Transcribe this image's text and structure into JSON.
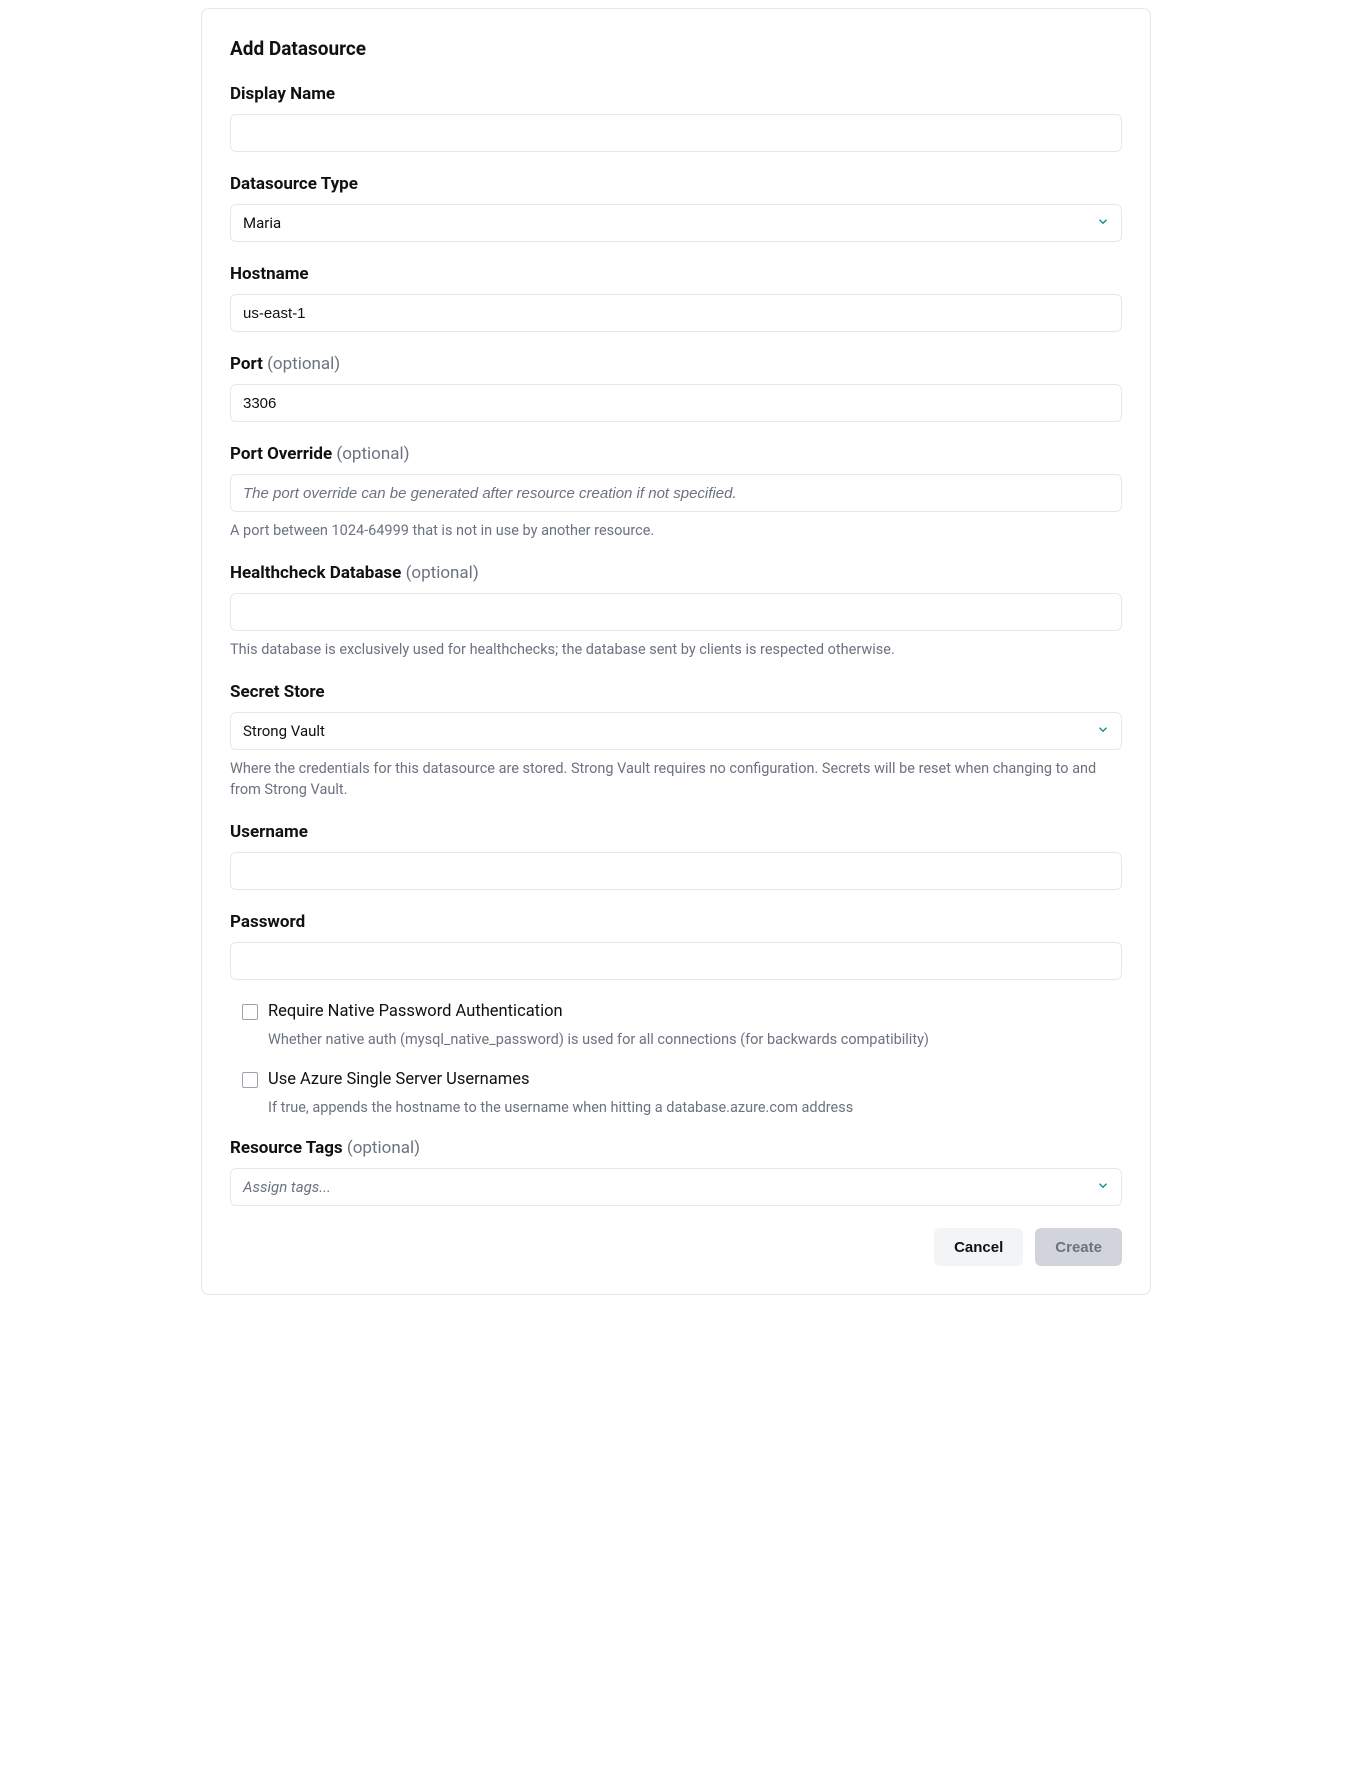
{
  "title": "Add Datasource",
  "fields": {
    "displayName": {
      "label": "Display Name",
      "value": ""
    },
    "datasourceType": {
      "label": "Datasource Type",
      "value": "Maria"
    },
    "hostname": {
      "label": "Hostname",
      "value": "us-east-1"
    },
    "port": {
      "label": "Port",
      "optional": "(optional)",
      "value": "3306"
    },
    "portOverride": {
      "label": "Port Override",
      "optional": "(optional)",
      "placeholder": "The port override can be generated after resource creation if not specified.",
      "help": "A port between 1024-64999 that is not in use by another resource."
    },
    "healthcheckDb": {
      "label": "Healthcheck Database",
      "optional": "(optional)",
      "value": "",
      "help": "This database is exclusively used for healthchecks; the database sent by clients is respected otherwise."
    },
    "secretStore": {
      "label": "Secret Store",
      "value": "Strong Vault",
      "help": "Where the credentials for this datasource are stored. Strong Vault requires no configuration. Secrets will be reset when changing to and from Strong Vault."
    },
    "username": {
      "label": "Username",
      "value": ""
    },
    "password": {
      "label": "Password",
      "value": ""
    },
    "requireNativePassword": {
      "label": "Require Native Password Authentication",
      "help": "Whether native auth (mysql_native_password) is used for all connections (for backwards compatibility)"
    },
    "azureUsernames": {
      "label": "Use Azure Single Server Usernames",
      "help": "If true, appends the hostname to the username when hitting a database.azure.com address"
    },
    "resourceTags": {
      "label": "Resource Tags",
      "optional": "(optional)",
      "placeholder": "Assign tags..."
    }
  },
  "actions": {
    "cancel": "Cancel",
    "create": "Create"
  }
}
